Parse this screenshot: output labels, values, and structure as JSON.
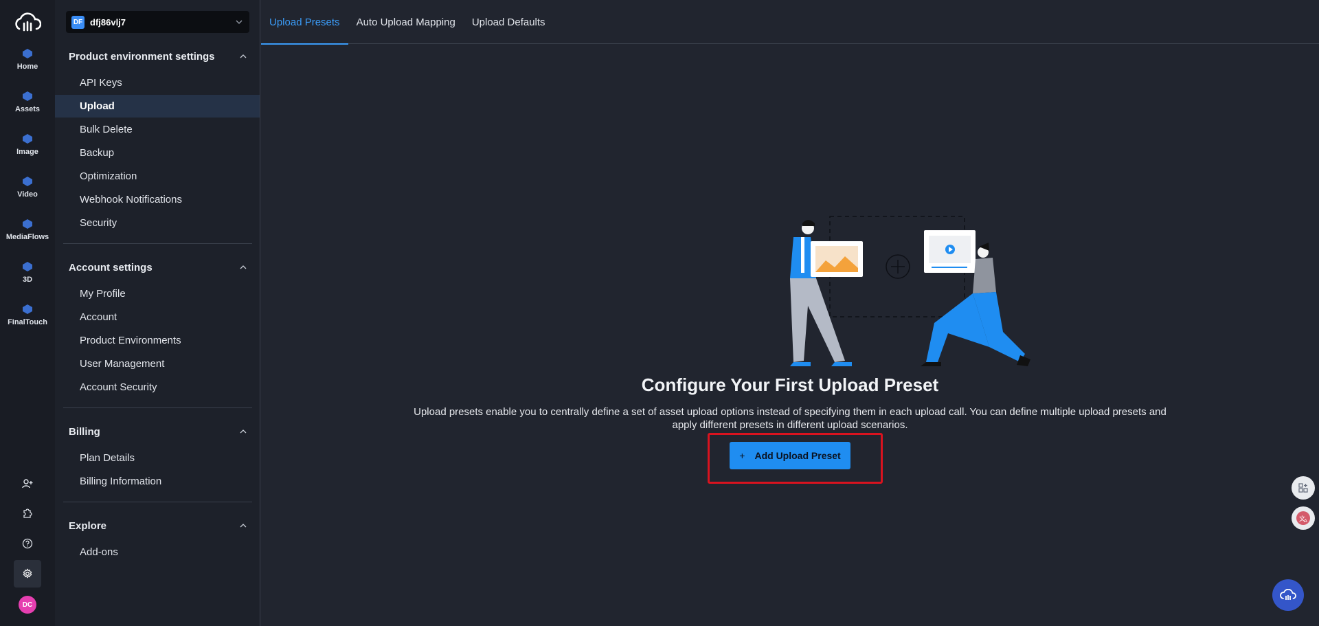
{
  "rail": {
    "items": [
      {
        "label": "Home",
        "icon": "home-icon"
      },
      {
        "label": "Assets",
        "icon": "assets-icon"
      },
      {
        "label": "Image",
        "icon": "image-icon"
      },
      {
        "label": "Video",
        "icon": "video-icon"
      },
      {
        "label": "MediaFlows",
        "icon": "mediaflows-icon"
      },
      {
        "label": "3D",
        "icon": "3d-icon"
      },
      {
        "label": "FinalTouch",
        "icon": "finaltouch-icon"
      }
    ],
    "avatar_initials": "DC"
  },
  "env": {
    "badge": "DF",
    "name": "dfj86vlj7"
  },
  "sidebar": {
    "sections": [
      {
        "title": "Product environment settings",
        "items": [
          "API Keys",
          "Upload",
          "Bulk Delete",
          "Backup",
          "Optimization",
          "Webhook Notifications",
          "Security"
        ]
      },
      {
        "title": "Account settings",
        "items": [
          "My Profile",
          "Account",
          "Product Environments",
          "User Management",
          "Account Security"
        ]
      },
      {
        "title": "Billing",
        "items": [
          "Plan Details",
          "Billing Information"
        ]
      },
      {
        "title": "Explore",
        "items": [
          "Add-ons"
        ]
      }
    ]
  },
  "tabs": [
    "Upload Presets",
    "Auto Upload Mapping",
    "Upload Defaults"
  ],
  "main": {
    "title": "Configure Your First Upload Preset",
    "description": "Upload presets enable you to centrally define a set of asset upload options instead of specifying them in each upload call. You can define multiple upload presets and apply different presets in different upload scenarios.",
    "button_plus": "+",
    "button_label": "Add Upload Preset"
  },
  "colors": {
    "accent": "#1f8df1",
    "highlight": "#d9131f",
    "background": "#21252f"
  }
}
